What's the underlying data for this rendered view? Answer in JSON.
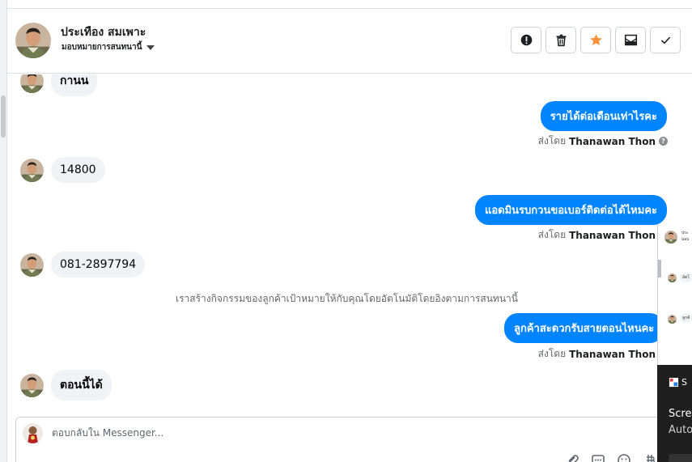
{
  "header": {
    "contact_name": "ประเทือง สมเพาะ",
    "assign_label": "มอบหมายการสนทนานี้",
    "actions": [
      "spam-alert",
      "trash",
      "star",
      "mark-unread",
      "done"
    ]
  },
  "messages": {
    "m1": {
      "text": "กานน"
    },
    "m2": {
      "text": "รายได้ต่อเดือนเท่าไรคะ",
      "sent_prefix": "ส่งโดย",
      "sender": "Thanawan Thon"
    },
    "m3": {
      "text": "14800"
    },
    "m4": {
      "text": "แอดมินรบกวนขอเบอร์ติดต่อได้ไหมคะ",
      "sent_prefix": "ส่งโดย",
      "sender": "Thanawan Thon"
    },
    "m5": {
      "text": "081-2897794"
    },
    "system_note": "เราสร้างกิจกรรมของลูกค้าเป้าหมายให้กับคุณโดยอัตโนมัติโดยอิงตามการสนทนานี้",
    "m6": {
      "text": "ลูกค้าสะดวกรับสายตอนไหนคะ",
      "sent_prefix": "ส่งโดย",
      "sender": "Thanawan Thon"
    },
    "m7": {
      "text": "ตอนนี้ได้"
    }
  },
  "composer": {
    "placeholder": "ตอบกลับใน Messenger..."
  },
  "side_panel": {
    "name_snippet": "ประ",
    "sub_snippet": "มอบ",
    "b1": "อัตโ",
    "b2": "ลูกค้"
  },
  "notification": {
    "app": "S",
    "title": "Screen",
    "body": "Auto"
  },
  "colors": {
    "accent": "#0084ff",
    "bubble_in": "#f0f2f5",
    "star": "#f7923b"
  }
}
